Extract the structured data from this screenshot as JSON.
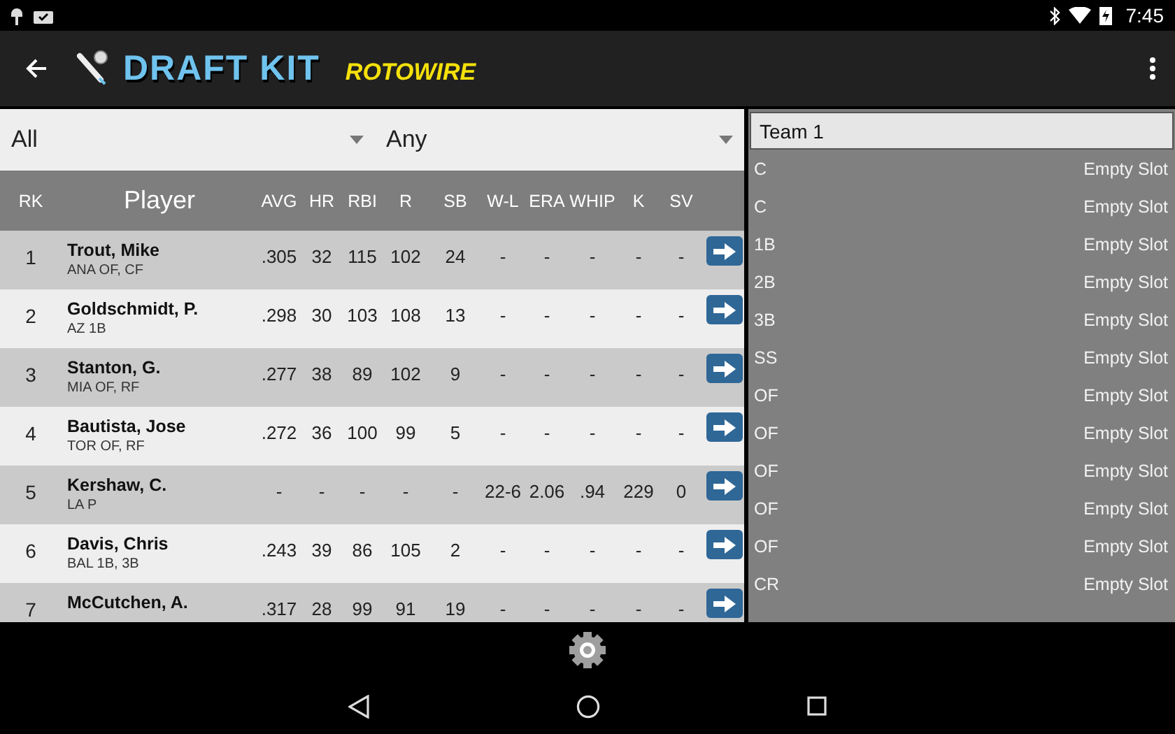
{
  "status_bar": {
    "time": "7:45"
  },
  "app_bar": {
    "title": "DRAFT KIT",
    "brand": "ROTOWIRE"
  },
  "filters": [
    {
      "value": "All"
    },
    {
      "value": "Any"
    }
  ],
  "table": {
    "columns": [
      "RK",
      "Player",
      "AVG",
      "HR",
      "RBI",
      "R",
      "SB",
      "W-L",
      "ERA",
      "WHIP",
      "K",
      "SV"
    ],
    "rows": [
      {
        "rank": "1",
        "name": "Trout, Mike",
        "details": "ANA OF, CF",
        "stats": [
          ".305",
          "32",
          "115",
          "102",
          "24",
          "-",
          "-",
          "-",
          "-",
          "-"
        ]
      },
      {
        "rank": "2",
        "name": "Goldschmidt, P.",
        "details": "AZ 1B",
        "stats": [
          ".298",
          "30",
          "103",
          "108",
          "13",
          "-",
          "-",
          "-",
          "-",
          "-"
        ]
      },
      {
        "rank": "3",
        "name": "Stanton, G.",
        "details": "MIA OF, RF",
        "stats": [
          ".277",
          "38",
          "89",
          "102",
          "9",
          "-",
          "-",
          "-",
          "-",
          "-"
        ]
      },
      {
        "rank": "4",
        "name": "Bautista, Jose",
        "details": "TOR OF, RF",
        "stats": [
          ".272",
          "36",
          "100",
          "99",
          "5",
          "-",
          "-",
          "-",
          "-",
          "-"
        ]
      },
      {
        "rank": "5",
        "name": "Kershaw, C.",
        "details": "LA P",
        "stats": [
          "-",
          "-",
          "-",
          "-",
          "-",
          "22-6",
          "2.06",
          ".94",
          "229",
          "0"
        ]
      },
      {
        "rank": "6",
        "name": "Davis, Chris",
        "details": "BAL 1B, 3B",
        "stats": [
          ".243",
          "39",
          "86",
          "105",
          "2",
          "-",
          "-",
          "-",
          "-",
          "-"
        ]
      },
      {
        "rank": "7",
        "name": "McCutchen, A.",
        "stats": [
          ".317",
          "28",
          "99",
          "91",
          "19",
          "-",
          "-",
          "-",
          "-",
          "-"
        ]
      }
    ]
  },
  "team_panel": {
    "title": "Team 1",
    "slots": [
      {
        "position": "C",
        "player": "Empty Slot"
      },
      {
        "position": "C",
        "player": "Empty Slot"
      },
      {
        "position": "1B",
        "player": "Empty Slot"
      },
      {
        "position": "2B",
        "player": "Empty Slot"
      },
      {
        "position": "3B",
        "player": "Empty Slot"
      },
      {
        "position": "SS",
        "player": "Empty Slot"
      },
      {
        "position": "OF",
        "player": "Empty Slot"
      },
      {
        "position": "OF",
        "player": "Empty Slot"
      },
      {
        "position": "OF",
        "player": "Empty Slot"
      },
      {
        "position": "OF",
        "player": "Empty Slot"
      },
      {
        "position": "OF",
        "player": "Empty Slot"
      },
      {
        "position": "CR",
        "player": "Empty Slot"
      }
    ]
  }
}
